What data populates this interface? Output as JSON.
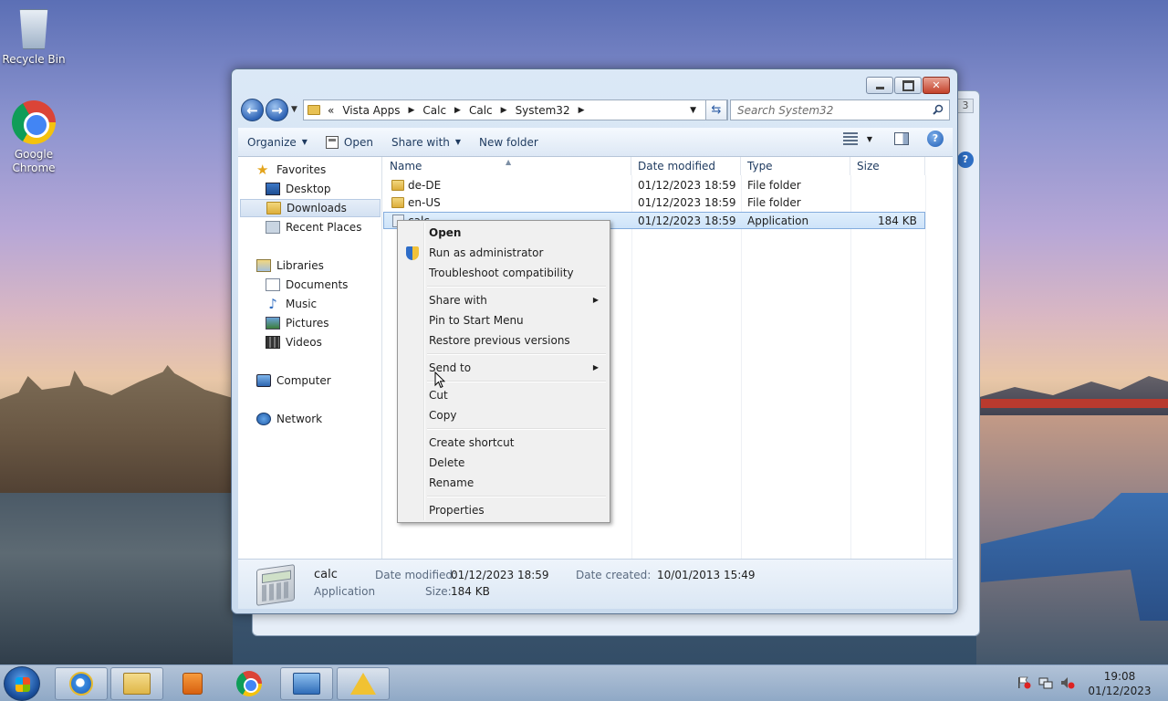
{
  "desktop": {
    "icons": [
      {
        "label": "Recycle Bin"
      },
      {
        "label": "Google\nChrome"
      }
    ]
  },
  "explorer": {
    "address": {
      "overflow": "«",
      "parts": [
        "Vista Apps",
        "Calc",
        "Calc",
        "System32"
      ]
    },
    "search_placeholder": "Search System32",
    "toolbar": {
      "organize": "Organize",
      "open": "Open",
      "share_with": "Share with",
      "new_folder": "New folder"
    },
    "nav_pane": {
      "favorites": "Favorites",
      "desktop": "Desktop",
      "downloads": "Downloads",
      "recent_places": "Recent Places",
      "libraries": "Libraries",
      "documents": "Documents",
      "music": "Music",
      "pictures": "Pictures",
      "videos": "Videos",
      "computer": "Computer",
      "network": "Network"
    },
    "columns": {
      "name": "Name",
      "date_modified": "Date modified",
      "type": "Type",
      "size": "Size"
    },
    "rows": [
      {
        "name": "de-DE",
        "date": "01/12/2023 18:59",
        "type": "File folder",
        "size": ""
      },
      {
        "name": "en-US",
        "date": "01/12/2023 18:59",
        "type": "File folder",
        "size": ""
      },
      {
        "name": "calc",
        "date": "01/12/2023 18:59",
        "type": "Application",
        "size": "184 KB"
      }
    ],
    "details": {
      "name": "calc",
      "kind": "Application",
      "date_modified_label": "Date modified:",
      "date_modified": "01/12/2023 18:59",
      "date_created_label": "Date created:",
      "date_created": "10/01/2013 15:49",
      "size_label": "Size:",
      "size": "184 KB"
    }
  },
  "context_menu": {
    "open": "Open",
    "run_as_admin": "Run as administrator",
    "troubleshoot": "Troubleshoot compatibility",
    "share_with": "Share with",
    "pin_start": "Pin to Start Menu",
    "restore": "Restore previous versions",
    "send_to": "Send to",
    "cut": "Cut",
    "copy": "Copy",
    "create_shortcut": "Create shortcut",
    "delete": "Delete",
    "rename": "Rename",
    "properties": "Properties"
  },
  "taskbar": {
    "time": "19:08",
    "date": "01/12/2023"
  }
}
